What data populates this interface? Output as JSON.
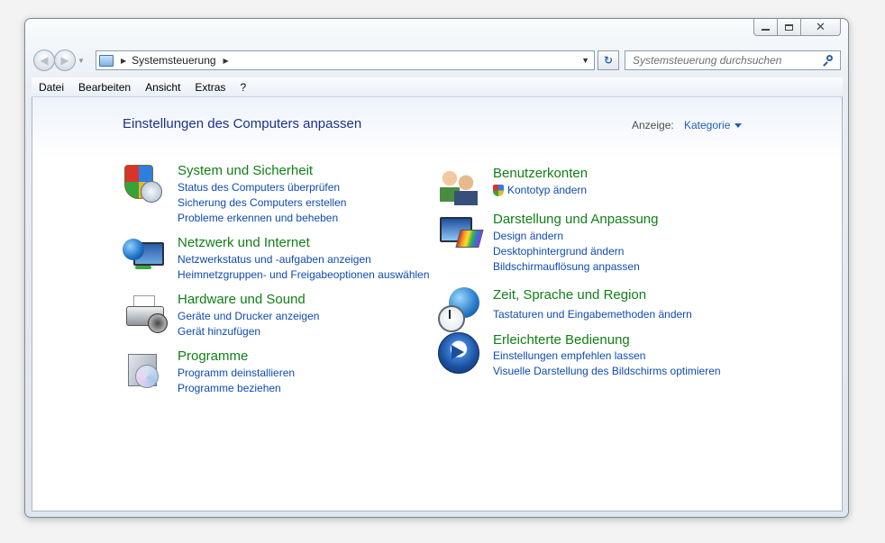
{
  "window": {
    "caption_close": "✕"
  },
  "nav": {
    "back_glyph": "◀",
    "forward_glyph": "▶"
  },
  "address": {
    "separator": "▶",
    "breadcrumb": "Systemsteuerung",
    "dropdown_glyph": "▼",
    "refresh_glyph": "↻"
  },
  "search": {
    "placeholder": "Systemsteuerung durchsuchen"
  },
  "menu": [
    "Datei",
    "Bearbeiten",
    "Ansicht",
    "Extras",
    "?"
  ],
  "content": {
    "title": "Einstellungen des Computers anpassen",
    "view_by_label": "Anzeige:",
    "view_by_value": "Kategorie"
  },
  "categories_left": [
    {
      "title": "System und Sicherheit",
      "icon": "shield-icon",
      "links": [
        "Status des Computers überprüfen",
        "Sicherung des Computers erstellen",
        "Probleme erkennen und beheben"
      ]
    },
    {
      "title": "Netzwerk und Internet",
      "icon": "network-globe-icon",
      "links": [
        "Netzwerkstatus und -aufgaben anzeigen",
        "Heimnetzgruppen- und Freigabeoptionen auswählen"
      ]
    },
    {
      "title": "Hardware und Sound",
      "icon": "printer-icon",
      "links": [
        "Geräte und Drucker anzeigen",
        "Gerät hinzufügen"
      ]
    },
    {
      "title": "Programme",
      "icon": "program-box-icon",
      "links": [
        "Programm deinstallieren",
        "Programme beziehen"
      ]
    }
  ],
  "categories_right": [
    {
      "title": "Benutzerkonten",
      "icon": "users-icon",
      "links": [
        "Kontotyp ändern"
      ]
    },
    {
      "title": "Darstellung und Anpassung",
      "icon": "display-icon",
      "links": [
        "Design ändern",
        "Desktophintergrund ändern",
        "Bildschirmauflösung anpassen"
      ]
    },
    {
      "title": "Zeit, Sprache und Region",
      "icon": "clock-globe-icon",
      "links": [
        "Tastaturen und Eingabemethoden ändern"
      ]
    },
    {
      "title": "Erleichterte Bedienung",
      "icon": "ease-of-access-icon",
      "links": [
        "Einstellungen empfehlen lassen",
        "Visuelle Darstellung des Bildschirms optimieren"
      ]
    }
  ]
}
